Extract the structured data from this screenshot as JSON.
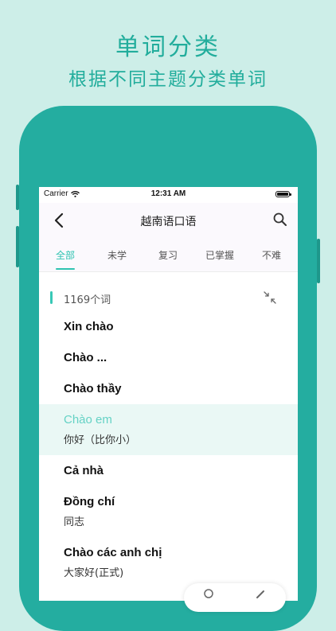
{
  "promo": {
    "title": "单词分类",
    "subtitle": "根据不同主题分类单词"
  },
  "status_bar": {
    "carrier": "Carrier",
    "time": "12:31 AM"
  },
  "nav": {
    "title": "越南语口语"
  },
  "tabs": [
    {
      "label": "全部",
      "active": true
    },
    {
      "label": "未学",
      "active": false
    },
    {
      "label": "复习",
      "active": false
    },
    {
      "label": "已掌握",
      "active": false
    },
    {
      "label": "不难",
      "active": false
    }
  ],
  "count_label": "1169个词",
  "words": [
    {
      "vi": "Xin chào",
      "zh": ""
    },
    {
      "vi": "Chào ...",
      "zh": ""
    },
    {
      "vi": "Chào thầy",
      "zh": ""
    },
    {
      "vi": "Chào em",
      "zh": "你好（比你小）",
      "highlighted": true
    },
    {
      "vi": "Cả nhà",
      "zh": ""
    },
    {
      "vi": "Đồng chí",
      "zh": "同志"
    },
    {
      "vi": "Chào các anh chị",
      "zh": "大家好(正式)"
    }
  ],
  "colors": {
    "background": "#cdeee8",
    "phone_frame": "#24ada0",
    "accent": "#2fc3b1",
    "promo_text": "#22ad9c",
    "highlight_row": "#eaf8f5"
  },
  "icons": {
    "back": "chevron-left-icon",
    "search": "search-icon",
    "collapse": "collapse-arrows-icon",
    "wifi": "wifi-icon",
    "battery": "battery-icon",
    "pencil": "pencil-icon"
  }
}
